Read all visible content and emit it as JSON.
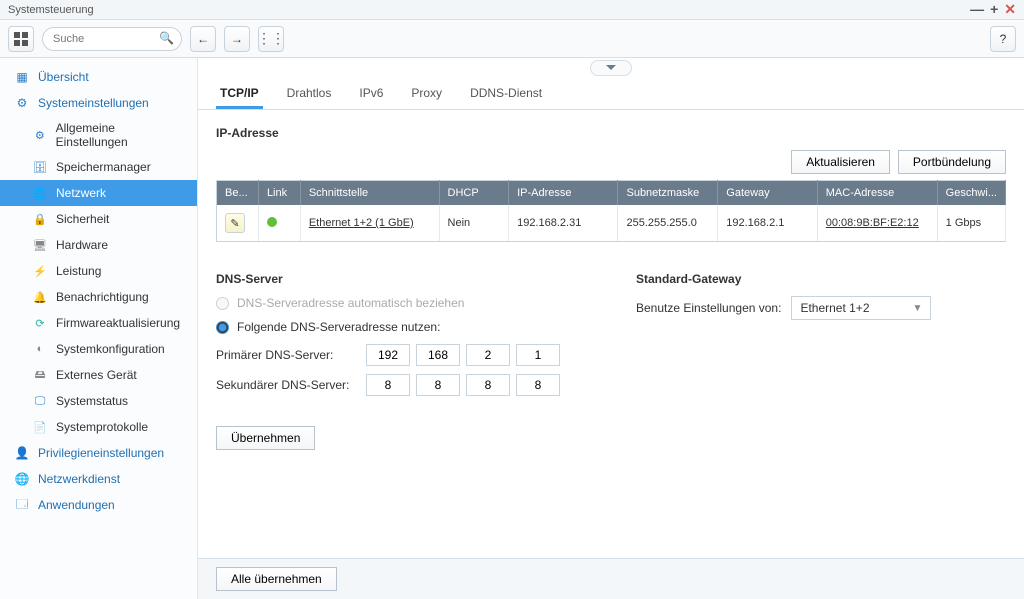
{
  "window": {
    "title": "Systemsteuerung"
  },
  "toolbar": {
    "search_placeholder": "Suche"
  },
  "sidebar": {
    "overview": "Übersicht",
    "system": "Systemeinstellungen",
    "items": [
      {
        "label": "Allgemeine Einstellungen"
      },
      {
        "label": "Speichermanager"
      },
      {
        "label": "Netzwerk"
      },
      {
        "label": "Sicherheit"
      },
      {
        "label": "Hardware"
      },
      {
        "label": "Leistung"
      },
      {
        "label": "Benachrichtigung"
      },
      {
        "label": "Firmwareaktualisierung"
      },
      {
        "label": "Systemkonfiguration"
      },
      {
        "label": "Externes Gerät"
      },
      {
        "label": "Systemstatus"
      },
      {
        "label": "Systemprotokolle"
      }
    ],
    "privileges": "Privilegieneinstellungen",
    "network_service": "Netzwerkdienst",
    "apps": "Anwendungen"
  },
  "tabs": [
    {
      "label": "TCP/IP"
    },
    {
      "label": "Drahtlos"
    },
    {
      "label": "IPv6"
    },
    {
      "label": "Proxy"
    },
    {
      "label": "DDNS-Dienst"
    }
  ],
  "ip_section": {
    "title": "IP-Adresse",
    "refresh": "Aktualisieren",
    "portbond": "Portbündelung",
    "headers": {
      "edit": "Be...",
      "link": "Link",
      "iface": "Schnittstelle",
      "dhcp": "DHCP",
      "ip": "IP-Adresse",
      "mask": "Subnetzmaske",
      "gateway": "Gateway",
      "mac": "MAC-Adresse",
      "speed": "Geschwi..."
    },
    "row": {
      "iface": "Ethernet 1+2 (1 GbE)",
      "dhcp": "Nein",
      "ip": "192.168.2.31",
      "mask": "255.255.255.0",
      "gateway": "192.168.2.1",
      "mac": "00:08:9B:BF:E2:12",
      "speed": "1 Gbps"
    }
  },
  "dns_section": {
    "title": "DNS-Server",
    "auto_label": "DNS-Serveradresse automatisch beziehen",
    "manual_label": "Folgende DNS-Serveradresse nutzen:",
    "primary_label": "Primärer DNS-Server:",
    "secondary_label": "Sekundärer DNS-Server:",
    "primary": [
      "192",
      "168",
      "2",
      "1"
    ],
    "secondary": [
      "8",
      "8",
      "8",
      "8"
    ],
    "apply": "Übernehmen"
  },
  "gateway_section": {
    "title": "Standard-Gateway",
    "use_label": "Benutze Einstellungen von:",
    "value": "Ethernet 1+2"
  },
  "footer": {
    "apply_all": "Alle übernehmen"
  }
}
